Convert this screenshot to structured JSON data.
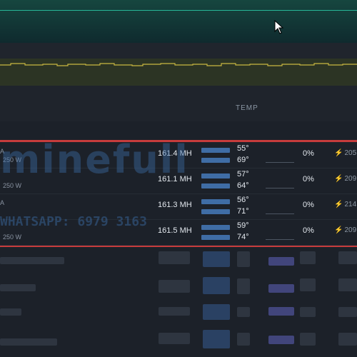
{
  "table_header": {
    "temp_label": "TEMP"
  },
  "rigs": [
    {
      "hashrate": "161.4 MH",
      "temp_core": "55°",
      "temp_mem": "69°",
      "fan": "0%",
      "power": "205",
      "ghost_top": "A",
      "ghost_bottom": "250 W"
    },
    {
      "hashrate": "161.1 MH",
      "temp_core": "57°",
      "temp_mem": "64°",
      "fan": "0%",
      "power": "209",
      "ghost_top": "",
      "ghost_bottom": "250 W"
    },
    {
      "hashrate": "161.3 MH",
      "temp_core": "56°",
      "temp_mem": "71°",
      "fan": "0%",
      "power": "214",
      "ghost_top": "A",
      "ghost_bottom": ""
    },
    {
      "hashrate": "161.5 MH",
      "temp_core": "59°",
      "temp_mem": "74°",
      "fan": "0%",
      "power": "209",
      "ghost_top": "",
      "ghost_bottom": "250 W"
    }
  ],
  "watermark": {
    "brand": "minefull",
    "contact": "WHATSAPP: 6979 3163"
  },
  "colors": {
    "highlight": "#c73c3c",
    "teal": "#2cd4b0",
    "yellow": "#c9b640",
    "bar_blue": "#3f6da5"
  },
  "icons": {
    "power": "bolt-icon",
    "cursor": "mouse-pointer-icon"
  }
}
